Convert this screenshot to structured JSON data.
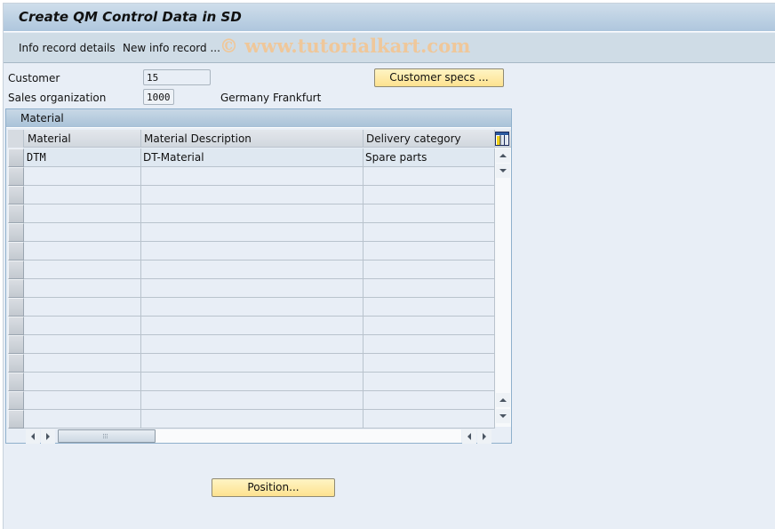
{
  "window": {
    "title": "Create QM Control Data in SD"
  },
  "toolbar": {
    "items": [
      {
        "label": "Info record details"
      },
      {
        "label": "New info record ..."
      }
    ],
    "watermark": "© www.tutorialkart.com"
  },
  "header": {
    "customer": {
      "label": "Customer",
      "value": "15"
    },
    "sales_org": {
      "label": "Sales organization",
      "value": "1000",
      "description": "Germany Frankfurt"
    },
    "customer_specs_button": "Customer specs ..."
  },
  "table": {
    "caption": "Material",
    "columns": [
      {
        "label": "Material"
      },
      {
        "label": "Material Description"
      },
      {
        "label": "Delivery category"
      }
    ],
    "rows": [
      {
        "material": "DTM",
        "description": "DT-Material",
        "delivery_category": "Spare parts"
      }
    ],
    "empty_row_count": 14,
    "icons": {
      "layout": "table-layout-icon",
      "scroll_up": "scroll-up-icon",
      "scroll_down": "scroll-down-icon",
      "scroll_left": "scroll-left-icon",
      "scroll_right": "scroll-right-icon"
    }
  },
  "footer": {
    "position_button": "Position..."
  }
}
